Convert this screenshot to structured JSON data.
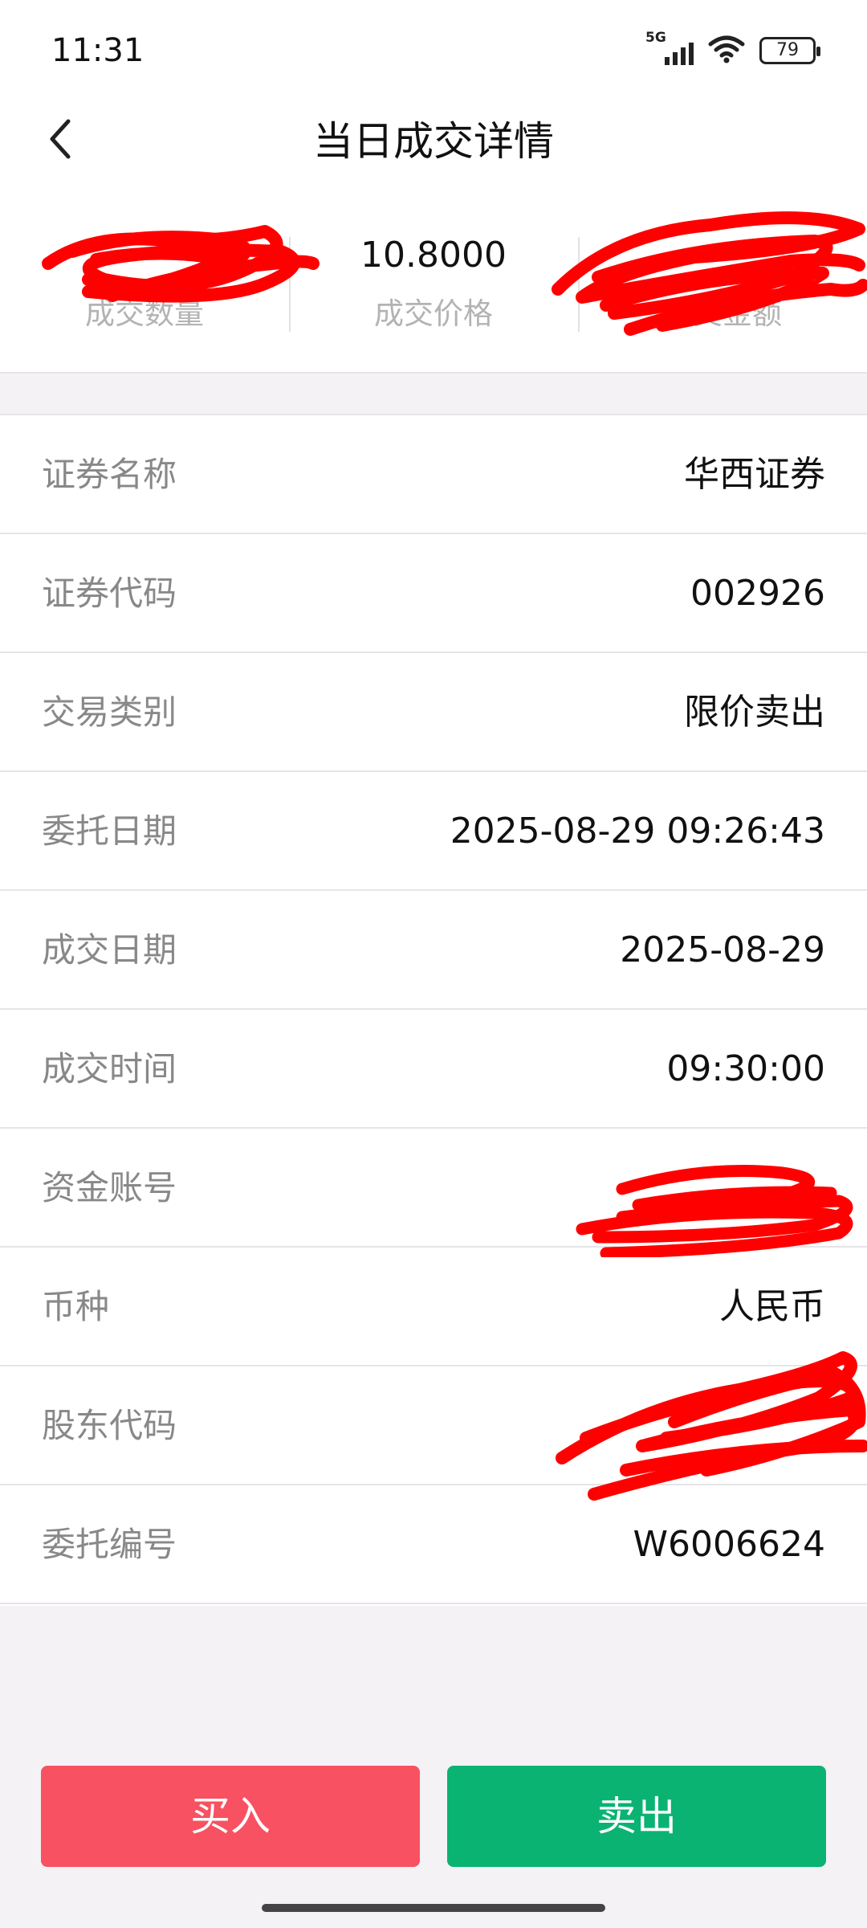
{
  "status_bar": {
    "time": "11:31",
    "network": "5G",
    "battery": "79"
  },
  "nav": {
    "title": "当日成交详情",
    "back_icon": "chevron-left-icon"
  },
  "summary": {
    "quantity_value": "",
    "quantity_label": "成交数量",
    "price_value": "10.8000",
    "price_label": "成交价格",
    "amount_value": "",
    "amount_label": "成交金额"
  },
  "details": [
    {
      "label": "证券名称",
      "value": "华西证券"
    },
    {
      "label": "证券代码",
      "value": "002926"
    },
    {
      "label": "交易类别",
      "value": "限价卖出"
    },
    {
      "label": "委托日期",
      "value": "2025-08-29 09:26:43"
    },
    {
      "label": "成交日期",
      "value": "2025-08-29"
    },
    {
      "label": "成交时间",
      "value": "09:30:00"
    },
    {
      "label": "资金账号",
      "value": ""
    },
    {
      "label": "币种",
      "value": "人民币"
    },
    {
      "label": "股东代码",
      "value": ""
    },
    {
      "label": "委托编号",
      "value": "W6006624"
    }
  ],
  "actions": {
    "buy_label": "买入",
    "sell_label": "卖出"
  },
  "colors": {
    "buy": "#f85161",
    "sell": "#0ab372",
    "redaction": "#ff0000"
  }
}
